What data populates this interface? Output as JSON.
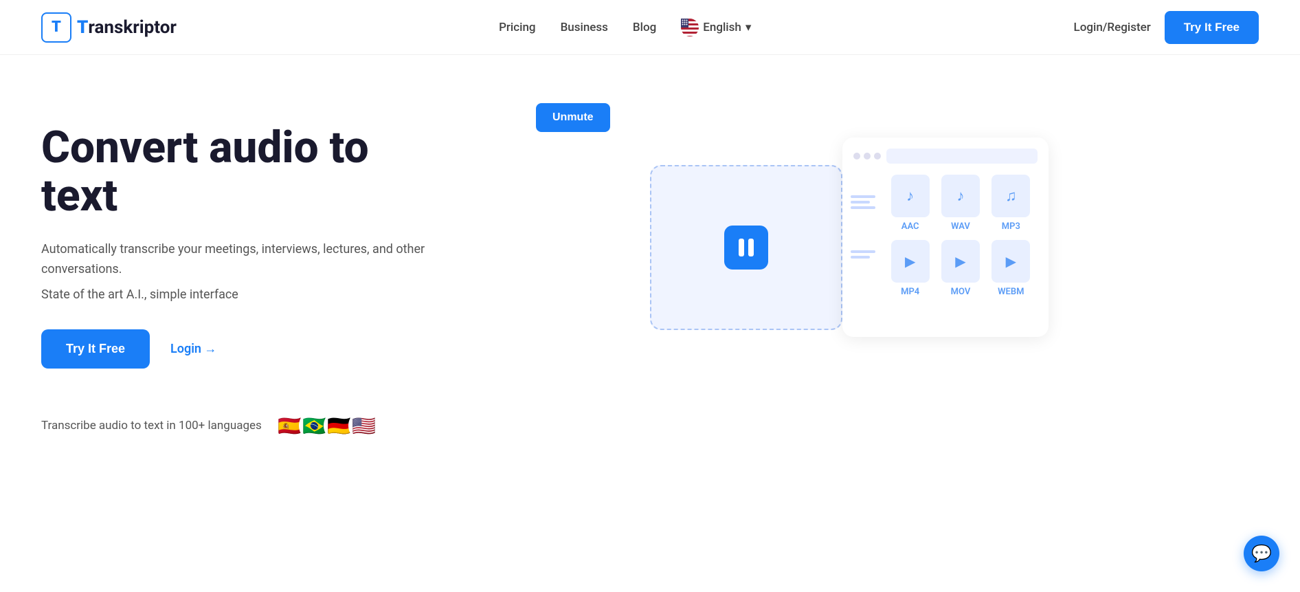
{
  "header": {
    "logo_letter": "T",
    "logo_name": "ranskriptor",
    "nav": {
      "pricing": "Pricing",
      "business": "Business",
      "blog": "Blog",
      "language": "English",
      "login_register": "Login/Register",
      "try_btn": "Try It Free"
    }
  },
  "hero": {
    "title": "Convert audio to text",
    "subtitle": "Automatically transcribe your meetings, interviews, lectures, and other conversations.",
    "tagline": "State of the art A.I., simple interface",
    "try_btn": "Try It Free",
    "login_link": "Login →",
    "languages_text": "Transcribe audio to text in 100+ languages",
    "flags": [
      "🇪🇸",
      "🇧🇷",
      "🇩🇪",
      "🇺🇸"
    ],
    "unmute_btn": "Unmute",
    "formats": [
      "AAC",
      "WAV",
      "MP3",
      "MP4",
      "MOV",
      "WEBM"
    ]
  },
  "chat": {
    "icon": "💬"
  }
}
